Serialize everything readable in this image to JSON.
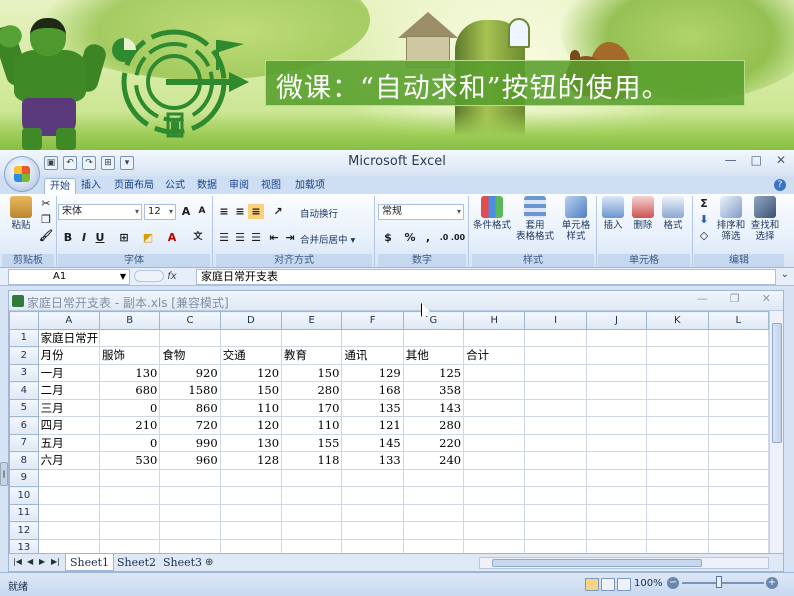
{
  "banner": {
    "title": "微课：“自动求和”按钮的使用。"
  },
  "window": {
    "title": "Microsoft Excel"
  },
  "ribbon": {
    "tabs": [
      "开始",
      "插入",
      "页面布局",
      "公式",
      "数据",
      "审阅",
      "视图",
      "加载项"
    ],
    "active_tab": "开始",
    "groups": {
      "clipboard": "剪贴板",
      "font": "字体",
      "alignment": "对齐方式",
      "number": "数字",
      "styles": "样式",
      "cells": "单元格",
      "editing": "编辑"
    },
    "paste_label": "粘贴",
    "font_name": "宋体",
    "font_size": "12",
    "wrap_text": "自动换行",
    "merge_center": "合并后居中",
    "number_format": "常规",
    "percent": "%",
    "comma": ",",
    "cond_format": "条件格式",
    "table_format_1": "套用",
    "table_format_2": "表格格式",
    "cell_style_1": "单元格",
    "cell_style_2": "样式",
    "insert": "插入",
    "delete": "删除",
    "format": "格式",
    "sort_filter_1": "排序和",
    "sort_filter_2": "筛选",
    "find_select_1": "查找和",
    "find_select_2": "选择",
    "bold": "B",
    "italic": "I",
    "underline": "U"
  },
  "formula_bar": {
    "name_box": "A1",
    "fx": "fx",
    "content": "家庭日常开支表"
  },
  "workbook": {
    "title": "家庭日常开支表 - 副本.xls  [兼容模式]",
    "columns": [
      "A",
      "B",
      "C",
      "D",
      "E",
      "F",
      "G",
      "H",
      "I",
      "J",
      "K",
      "L"
    ],
    "rows": [
      [
        "1",
        "家庭日常开支表",
        "",
        "",
        "",
        "",
        "",
        "",
        "",
        "",
        "",
        "",
        ""
      ],
      [
        "2",
        "月份",
        "服饰",
        "食物",
        "交通",
        "教育",
        "通讯",
        "其他",
        "合计",
        "",
        "",
        "",
        ""
      ],
      [
        "3",
        "一月",
        "130",
        "920",
        "120",
        "150",
        "129",
        "125",
        "",
        "",
        "",
        "",
        ""
      ],
      [
        "4",
        "二月",
        "680",
        "1580",
        "150",
        "280",
        "168",
        "358",
        "",
        "",
        "",
        "",
        ""
      ],
      [
        "5",
        "三月",
        "0",
        "860",
        "110",
        "170",
        "135",
        "143",
        "",
        "",
        "",
        "",
        ""
      ],
      [
        "6",
        "四月",
        "210",
        "720",
        "120",
        "110",
        "121",
        "280",
        "",
        "",
        "",
        "",
        ""
      ],
      [
        "7",
        "五月",
        "0",
        "990",
        "130",
        "155",
        "145",
        "220",
        "",
        "",
        "",
        "",
        ""
      ],
      [
        "8",
        "六月",
        "530",
        "960",
        "128",
        "118",
        "133",
        "240",
        "",
        "",
        "",
        "",
        ""
      ],
      [
        "9",
        "",
        "",
        "",
        "",
        "",
        "",
        "",
        "",
        "",
        "",
        "",
        ""
      ],
      [
        "10",
        "",
        "",
        "",
        "",
        "",
        "",
        "",
        "",
        "",
        "",
        "",
        ""
      ],
      [
        "11",
        "",
        "",
        "",
        "",
        "",
        "",
        "",
        "",
        "",
        "",
        "",
        ""
      ],
      [
        "12",
        "",
        "",
        "",
        "",
        "",
        "",
        "",
        "",
        "",
        "",
        "",
        ""
      ],
      [
        "13",
        "",
        "",
        "",
        "",
        "",
        "",
        "",
        "",
        "",
        "",
        "",
        ""
      ]
    ],
    "sheets": [
      "Sheet1",
      "Sheet2",
      "Sheet3"
    ],
    "active_sheet": "Sheet1"
  },
  "status": {
    "text": "就绪",
    "zoom": "100%",
    "zoom_minus": "−",
    "zoom_plus": "+"
  },
  "colors": {
    "banner_green": "#589e2c",
    "ribbon_blue": "#15428b"
  }
}
